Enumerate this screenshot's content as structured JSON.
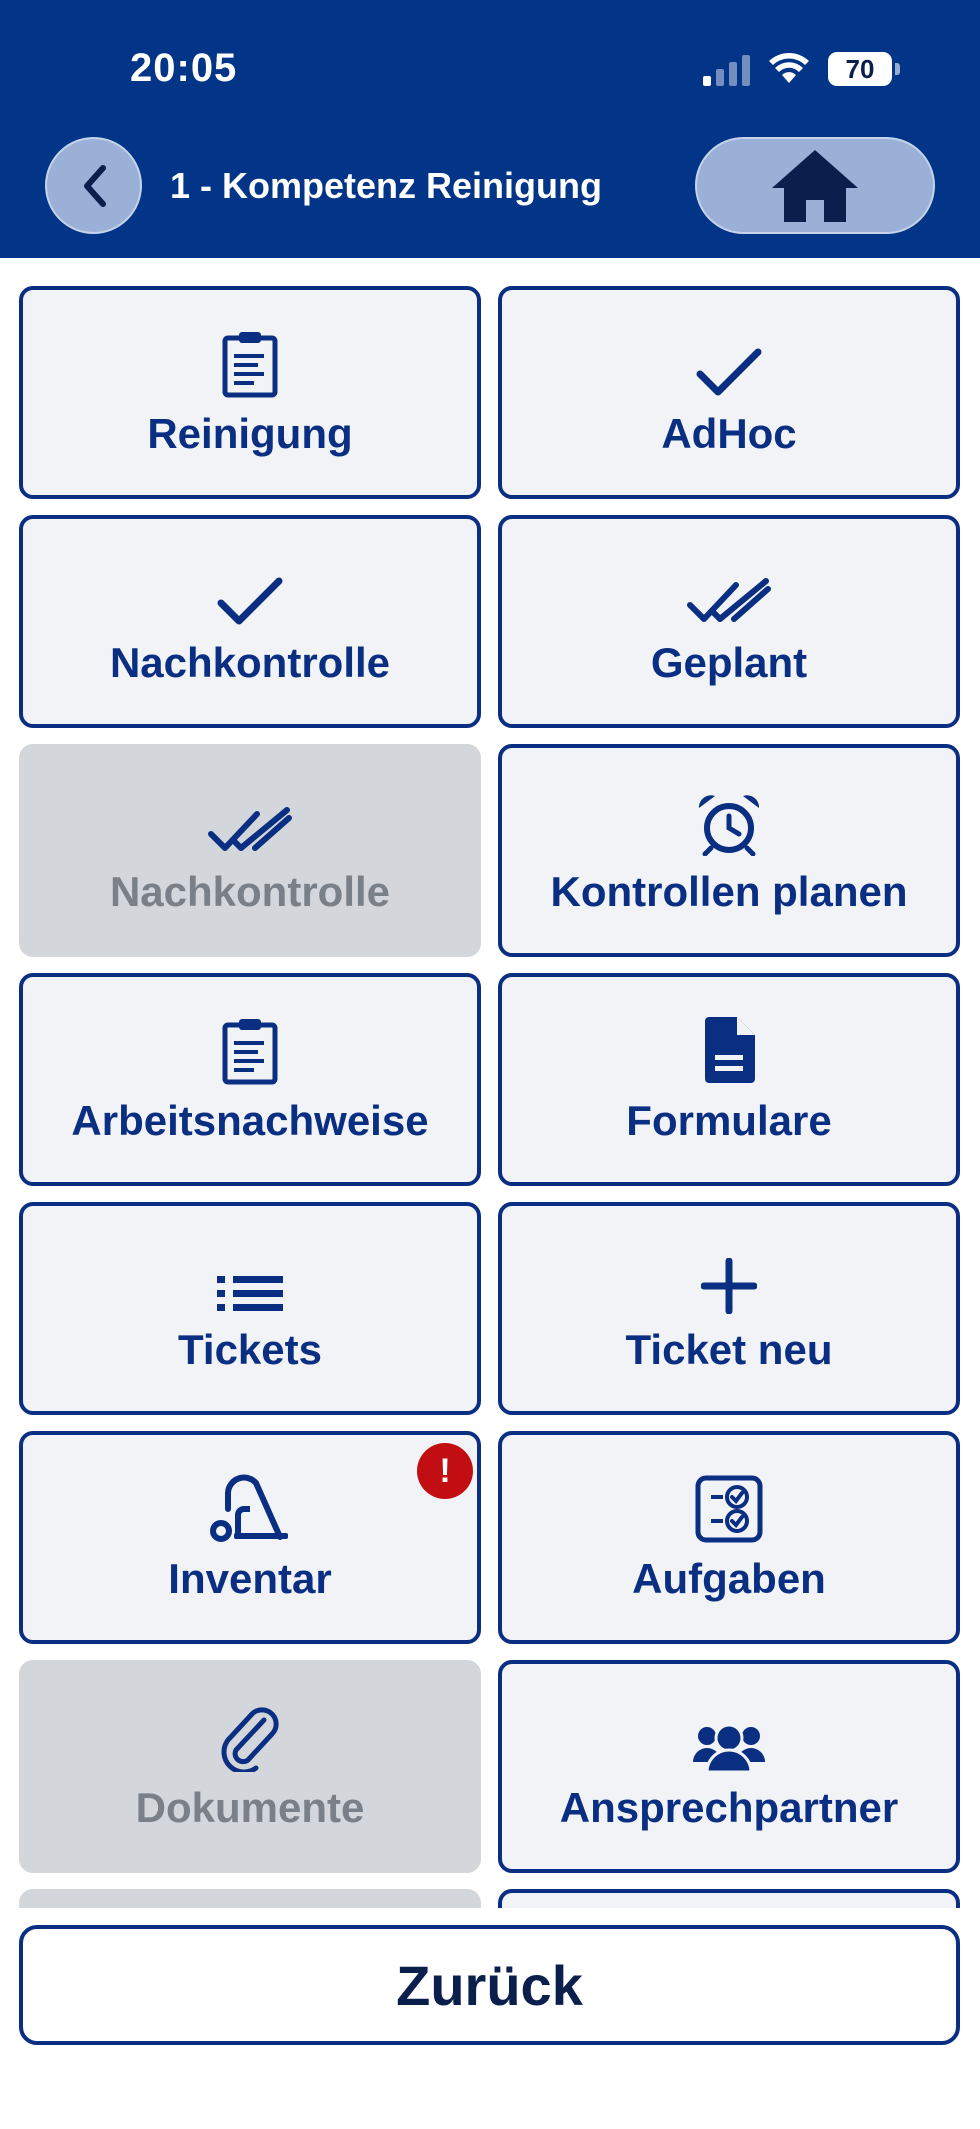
{
  "status_bar": {
    "time": "20:05",
    "battery": "70"
  },
  "header": {
    "title": "1 - Kompetenz Reinigung"
  },
  "tiles": [
    {
      "label": "Reinigung",
      "icon": "clipboard-icon",
      "enabled": true
    },
    {
      "label": "AdHoc",
      "icon": "check-icon",
      "enabled": true
    },
    {
      "label": "Nachkontrolle",
      "icon": "check-icon",
      "enabled": true
    },
    {
      "label": "Geplant",
      "icon": "double-check-icon",
      "enabled": true
    },
    {
      "label": "Nachkontrolle",
      "icon": "double-check-icon",
      "enabled": false
    },
    {
      "label": "Kontrollen planen",
      "icon": "alarm-clock-icon",
      "enabled": true
    },
    {
      "label": "Arbeitsnachweise",
      "icon": "clipboard-icon",
      "enabled": true
    },
    {
      "label": "Formulare",
      "icon": "document-icon",
      "enabled": true
    },
    {
      "label": "Tickets",
      "icon": "list-icon",
      "enabled": true
    },
    {
      "label": "Ticket neu",
      "icon": "plus-icon",
      "enabled": true
    },
    {
      "label": "Inventar",
      "icon": "vacuum-cleaner-icon",
      "enabled": true,
      "badge": "!"
    },
    {
      "label": "Aufgaben",
      "icon": "task-checklist-icon",
      "enabled": true
    },
    {
      "label": "Dokumente",
      "icon": "paperclip-icon",
      "enabled": false
    },
    {
      "label": "Ansprechpartner",
      "icon": "contacts-group-icon",
      "enabled": true
    }
  ],
  "footer": {
    "back_label": "Zurück"
  },
  "colors": {
    "header_bg": "#023487",
    "tile_border": "#0a2f82",
    "tile_bg": "#f1f3f6",
    "disabled_bg": "#d3d6da",
    "badge": "#c20e12"
  }
}
